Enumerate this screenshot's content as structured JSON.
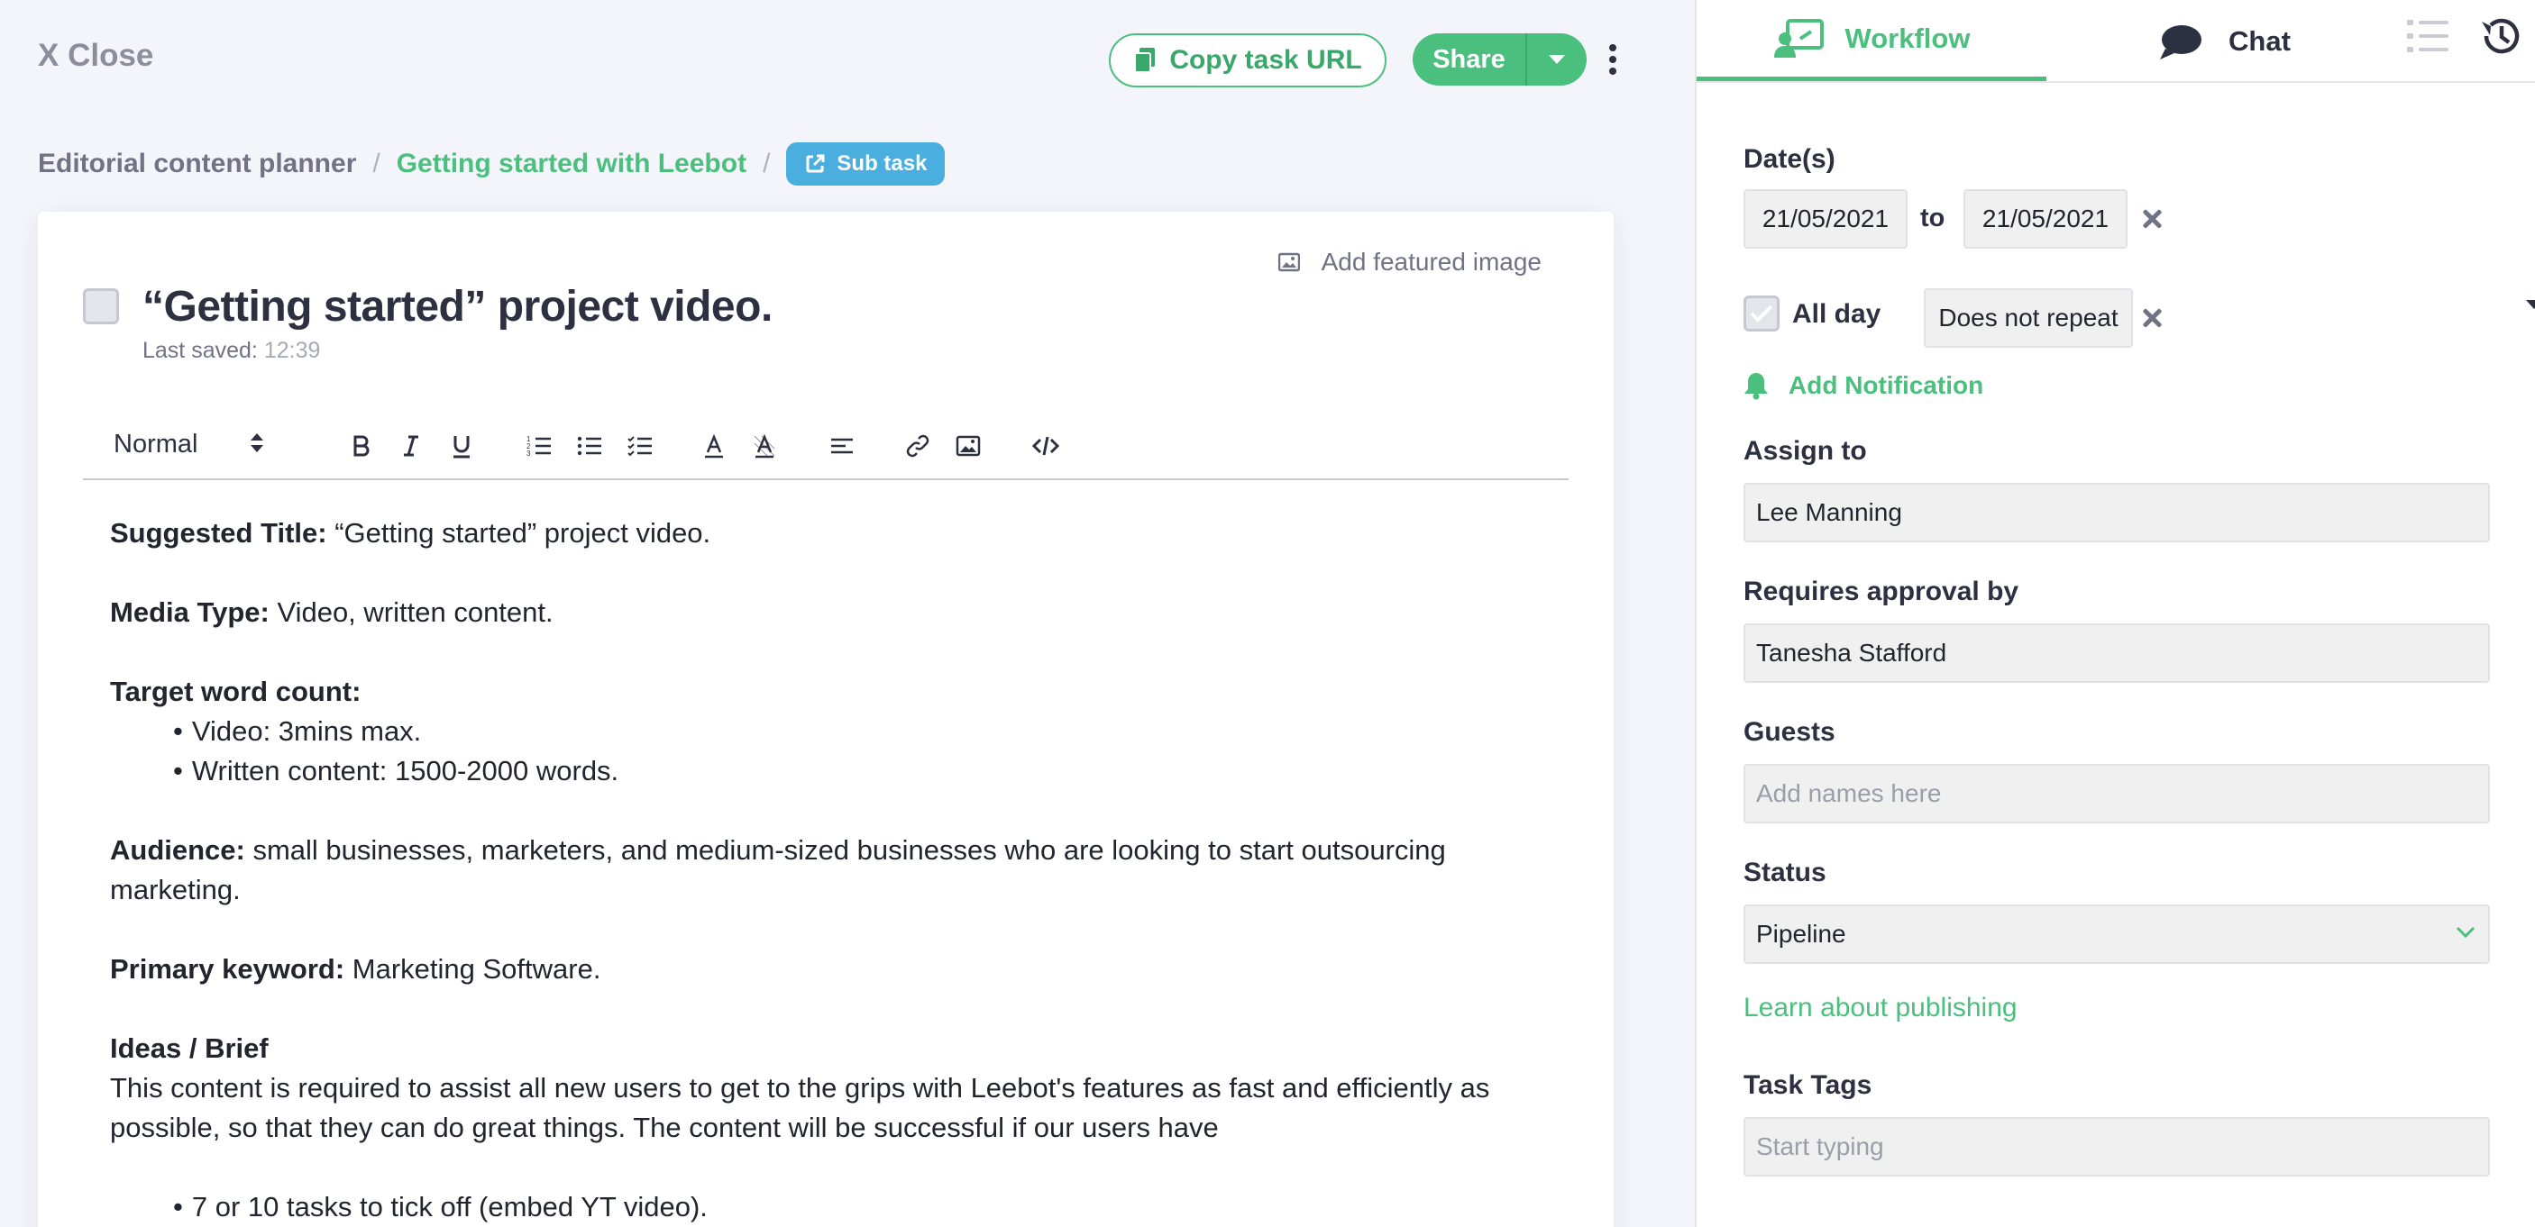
{
  "header": {
    "close_label": "X Close",
    "copy_url_label": "Copy task URL",
    "share_label": "Share"
  },
  "breadcrumb": {
    "items": [
      "Editorial content planner",
      "Getting started with Leebot"
    ],
    "separator": "/",
    "subtask_label": "Sub task"
  },
  "task": {
    "add_featured_label": "Add featured image",
    "title": "“Getting started” project video.",
    "last_saved_label": "Last saved: ",
    "last_saved_time": "12:39"
  },
  "toolbar": {
    "style_select": "Normal",
    "icons": [
      "bold-icon",
      "italic-icon",
      "underline-icon",
      "ordered-list-icon",
      "bullet-list-icon",
      "checklist-icon",
      "text-color-icon",
      "highlight-icon",
      "align-icon",
      "link-icon",
      "image-icon",
      "code-icon"
    ]
  },
  "content": {
    "suggested_title_label": "Suggested Title:",
    "suggested_title_value": " “Getting started” project video.",
    "media_type_label": "Media Type:",
    "media_type_value": " Video, written content.",
    "word_count_label": "Target word count:",
    "word_count_items": [
      "Video: 3mins max.",
      "Written content: 1500-2000 words."
    ],
    "audience_label": "Audience:",
    "audience_value": " small businesses, marketers, and medium-sized businesses who are looking to start outsourcing marketing.",
    "keyword_label": "Primary keyword:",
    "keyword_value": " Marketing Software.",
    "ideas_label": "Ideas / Brief",
    "ideas_text": "This content is required to assist all new users to get to the grips with Leebot's features as fast and efficiently as possible, so that they can do great things. The content will be successful if our users have",
    "ideas_items": [
      "7 or 10 tasks to tick off (embed YT video)."
    ]
  },
  "side": {
    "tab_workflow": "Workflow",
    "tab_chat": "Chat",
    "dates_label": "Date(s)",
    "date_from": "21/05/2021",
    "date_to_label": "to",
    "date_to": "21/05/2021",
    "all_day_label": "All day",
    "all_day_checked": true,
    "repeat_value": "Does not repeat",
    "add_notification_label": "Add Notification",
    "assign_label": "Assign to",
    "assign_value": "Lee Manning",
    "approval_label": "Requires approval by",
    "approval_value": "Tanesha Stafford",
    "guests_label": "Guests",
    "guests_placeholder": "Add names here",
    "status_label": "Status",
    "status_value": "Pipeline",
    "learn_link": "Learn about publishing",
    "tags_label": "Task Tags",
    "tags_placeholder": "Start typing"
  },
  "colors": {
    "accent": "#4bbf7d",
    "subtask": "#4aaedf",
    "background": "#f4f4fb"
  }
}
